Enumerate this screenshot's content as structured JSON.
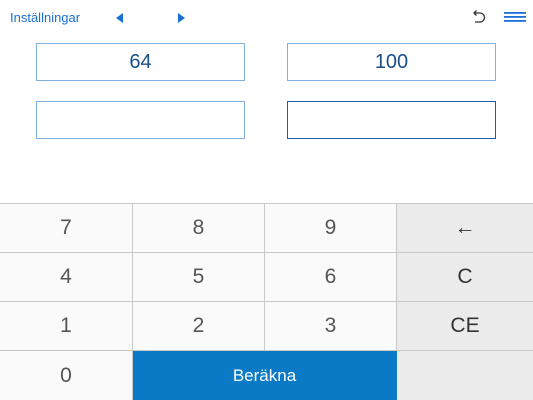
{
  "topbar": {
    "settings_label": "Inställningar",
    "accent_color": "#1a6fd4"
  },
  "fields": [
    {
      "value": "64",
      "active": false
    },
    {
      "value": "100",
      "active": false
    },
    {
      "value": "",
      "active": false
    },
    {
      "value": "",
      "active": true
    }
  ],
  "keypad": {
    "keys": {
      "k7": "7",
      "k8": "8",
      "k9": "9",
      "backspace": "←",
      "k4": "4",
      "k5": "5",
      "k6": "6",
      "clear": "C",
      "k1": "1",
      "k2": "2",
      "k3": "3",
      "clear_entry": "CE",
      "k0": "0",
      "calculate": "Beräkna"
    },
    "calculate_color": "#0a7ac6"
  },
  "icons": {
    "prev": "caret-left-icon",
    "next": "caret-right-icon",
    "undo": "undo-icon",
    "menu": "menu-icon"
  }
}
